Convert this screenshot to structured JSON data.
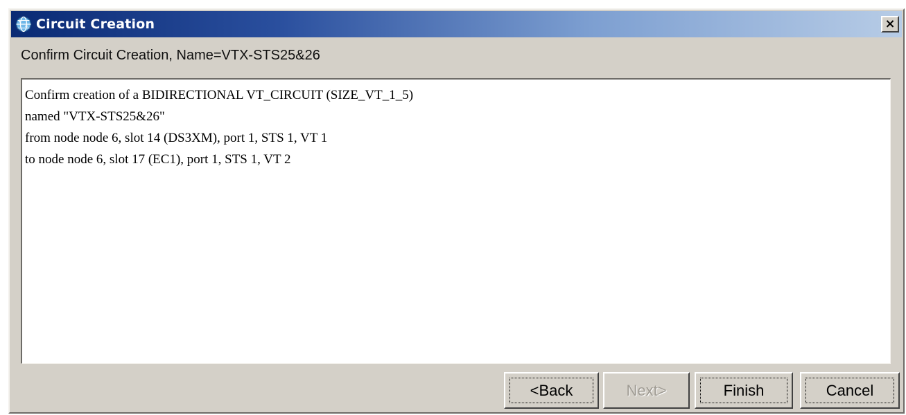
{
  "window": {
    "title": "Circuit Creation",
    "title_icon": "circuit-globe-icon",
    "close_label": "×"
  },
  "subtitle": "Confirm Circuit Creation, Name=VTX-STS25&26",
  "message": {
    "lines": [
      "Confirm creation of a BIDIRECTIONAL VT_CIRCUIT (SIZE_VT_1_5)",
      "named \"VTX-STS25&26\"",
      "from node node 6, slot 14 (DS3XM), port 1, STS 1, VT 1",
      "to node node 6, slot 17 (EC1), port 1, STS 1, VT 2"
    ]
  },
  "buttons": {
    "back": "<Back",
    "next": "Next>",
    "finish": "Finish",
    "cancel": "Cancel"
  },
  "colors": {
    "titlebar_start": "#0a2a74",
    "titlebar_end": "#b7cce6",
    "dialog_background": "#d4d0c8"
  }
}
